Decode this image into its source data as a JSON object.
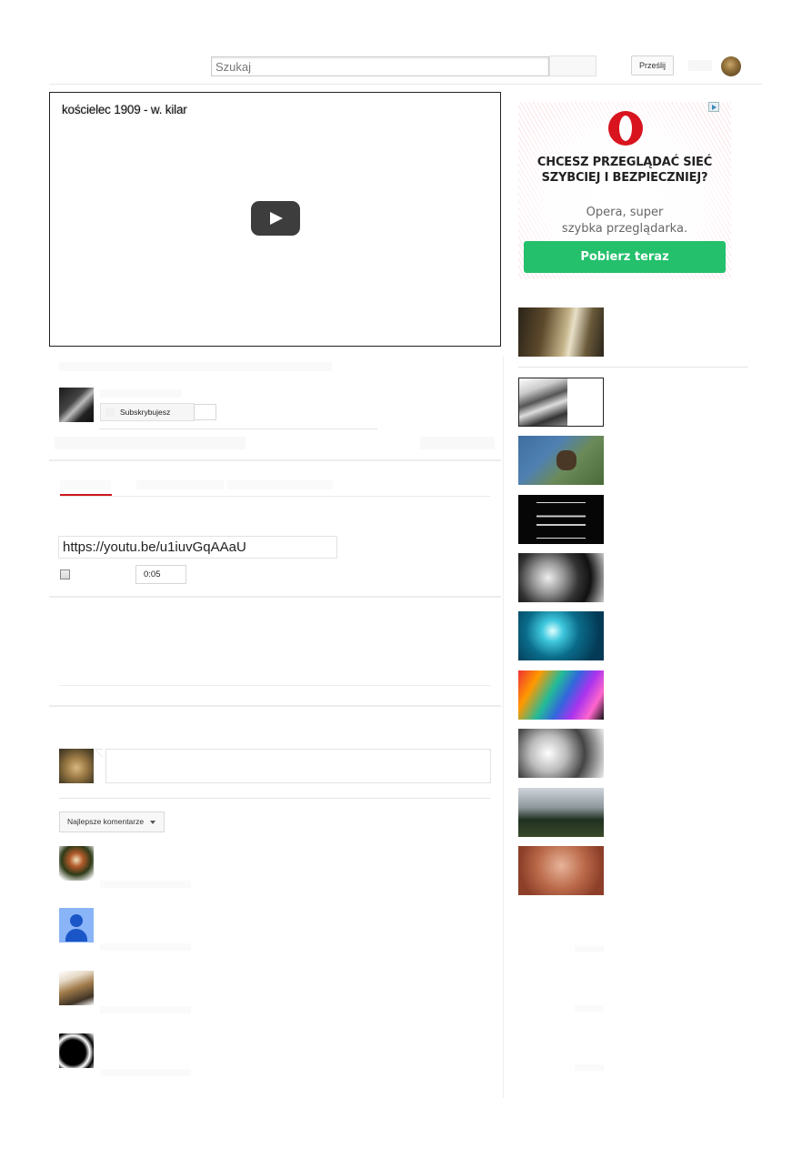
{
  "header": {
    "search_placeholder": "Szukaj",
    "upload_label": "Prześlij"
  },
  "player": {
    "title": "kościelec 1909 - w. kilar"
  },
  "channel": {
    "subscribe_label": "Subskrybujesz"
  },
  "share": {
    "url": "https://youtu.be/u1iuvGqAAaU",
    "start_time": "0:05"
  },
  "comments": {
    "sort_label": "Najlepsze komentarze"
  },
  "ad": {
    "headline": "CHCESZ PRZEGLĄDAĆ SIEĆ\nSZYBCIEJ I BEZPIECZNIEJ?",
    "subtext": "Opera, super\nszybka przeglądarka.",
    "cta": "Pobierz teraz"
  },
  "colors": {
    "accent_red": "#cc181e",
    "opera_red": "#d8141f",
    "cta_green": "#24c06b"
  },
  "icons": [
    "play-icon",
    "ad-choices-icon",
    "opera-logo-icon",
    "dropdown-caret-icon"
  ]
}
